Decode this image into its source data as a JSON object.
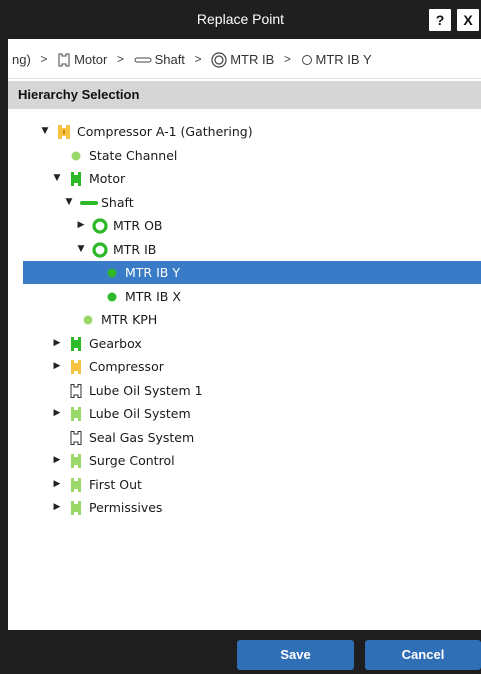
{
  "window": {
    "title": "Replace Point",
    "help_label": "?",
    "close_label": "X"
  },
  "breadcrumb": [
    {
      "label": "ng)",
      "icon": "none"
    },
    {
      "label": "Motor",
      "icon": "machine-outline-icon"
    },
    {
      "label": "Shaft",
      "icon": "shaft-outline-icon"
    },
    {
      "label": "MTR IB",
      "icon": "bearing-outline-icon"
    },
    {
      "label": "MTR IB Y",
      "icon": "point-outline-icon"
    }
  ],
  "breadcrumb_separator": ">",
  "section": {
    "title": "Hierarchy Selection"
  },
  "tree": [
    {
      "label": "Compressor A-1 (Gathering)",
      "level": 0,
      "caret": "expanded",
      "icon": "asset-yellow-icon",
      "selected": false
    },
    {
      "label": "State Channel",
      "level": 1,
      "caret": "none",
      "icon": "point-light-green-icon",
      "selected": false
    },
    {
      "label": "Motor",
      "level": 1,
      "caret": "expanded",
      "icon": "machine-green-icon",
      "selected": false
    },
    {
      "label": "Shaft",
      "level": 2,
      "caret": "expanded",
      "icon": "shaft-green-icon",
      "selected": false
    },
    {
      "label": "MTR OB",
      "level": 3,
      "caret": "collapsed",
      "icon": "bearing-green-icon",
      "selected": false
    },
    {
      "label": "MTR IB",
      "level": 3,
      "caret": "expanded",
      "icon": "bearing-green-icon",
      "selected": false
    },
    {
      "label": "MTR IB Y",
      "level": 4,
      "caret": "none",
      "icon": "point-green-icon",
      "selected": true
    },
    {
      "label": "MTR IB X",
      "level": 4,
      "caret": "none",
      "icon": "point-green-icon",
      "selected": false
    },
    {
      "label": "MTR KPH",
      "level": 2,
      "caret": "none",
      "icon": "point-light-green-icon",
      "selected": false
    },
    {
      "label": "Gearbox",
      "level": 1,
      "caret": "collapsed",
      "icon": "machine-green-icon",
      "selected": false
    },
    {
      "label": "Compressor",
      "level": 1,
      "caret": "collapsed",
      "icon": "machine-yellow-icon",
      "selected": false
    },
    {
      "label": "Lube Oil System 1",
      "level": 1,
      "caret": "none",
      "icon": "machine-outline-icon",
      "selected": false
    },
    {
      "label": "Lube Oil System",
      "level": 1,
      "caret": "collapsed",
      "icon": "machine-light-green-icon",
      "selected": false
    },
    {
      "label": "Seal Gas System",
      "level": 1,
      "caret": "none",
      "icon": "machine-outline-icon",
      "selected": false
    },
    {
      "label": "Surge Control",
      "level": 1,
      "caret": "collapsed",
      "icon": "machine-light-green-icon",
      "selected": false
    },
    {
      "label": "First Out",
      "level": 1,
      "caret": "collapsed",
      "icon": "machine-light-green-icon",
      "selected": false
    },
    {
      "label": "Permissives",
      "level": 1,
      "caret": "collapsed",
      "icon": "machine-light-green-icon",
      "selected": false
    }
  ],
  "footer": {
    "save_label": "Save",
    "cancel_label": "Cancel"
  },
  "colors": {
    "selection": "#3a7bc8",
    "status_green": "#2db928",
    "status_light_green": "#9ad86a",
    "status_yellow": "#f5c242",
    "button": "#2f6fb5"
  }
}
